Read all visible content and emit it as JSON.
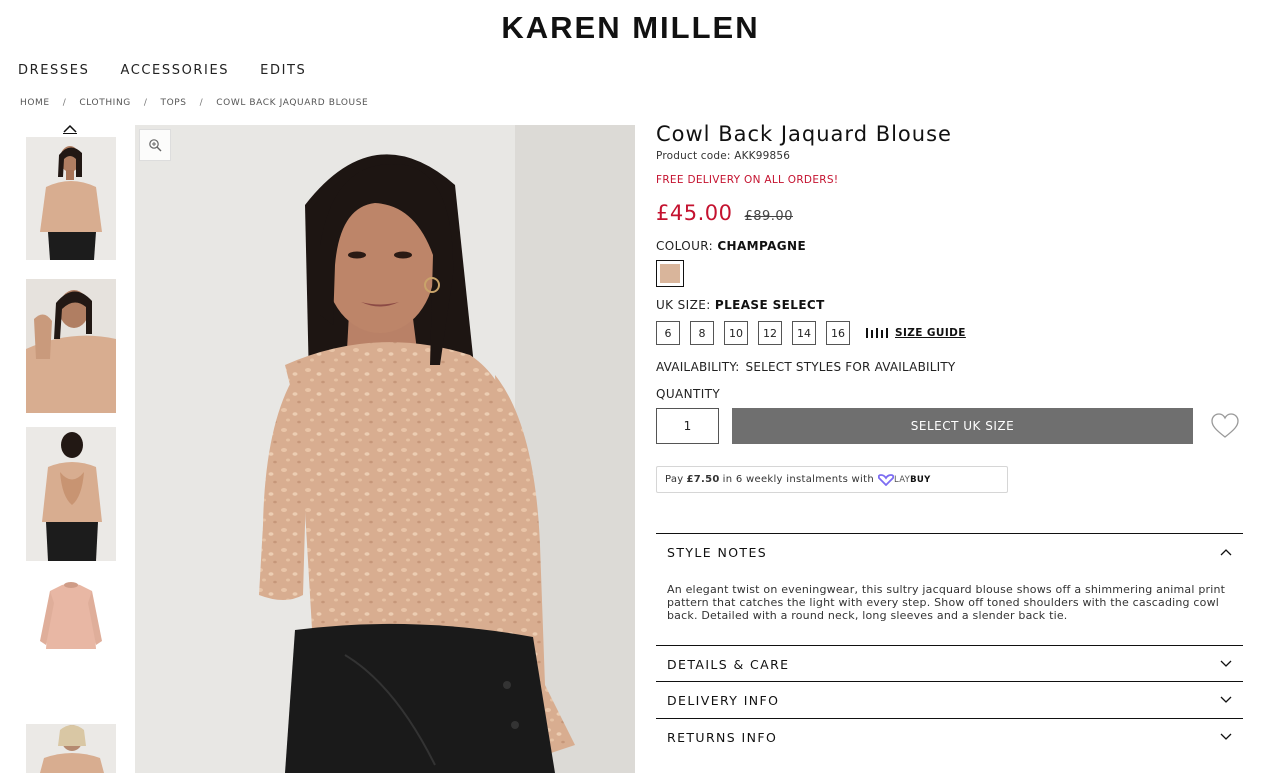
{
  "brand": "KAREN MILLEN",
  "nav": [
    "DRESSES",
    "ACCESSORIES",
    "EDITS"
  ],
  "breadcrumb": [
    "HOME",
    "CLOTHING",
    "TOPS",
    "COWL BACK JAQUARD BLOUSE"
  ],
  "product": {
    "title": "Cowl Back Jaquard Blouse",
    "code": "Product code: AKK99856",
    "promo": "FREE DELIVERY ON ALL ORDERS!",
    "price": "£45.00",
    "was_price": "£89.00",
    "colour_label": "COLOUR:",
    "colour_value": "CHAMPAGNE",
    "swatch_color": "#d9b59b",
    "size_label": "UK SIZE:",
    "size_value": "PLEASE SELECT",
    "sizes": [
      "6",
      "8",
      "10",
      "12",
      "14",
      "16"
    ],
    "size_guide": "SIZE GUIDE",
    "availability_label": "AVAILABILITY:",
    "availability_value": "SELECT STYLES FOR AVAILABILITY",
    "quantity_label": "QUANTITY",
    "quantity": "1",
    "cta": "SELECT UK SIZE"
  },
  "laybuy": {
    "pay": "Pay",
    "amount": "£7.50",
    "rest": "in 6 weekly instalments with",
    "logo_lay": "LAY",
    "logo_buy": "BUY"
  },
  "accordion": {
    "style_notes": {
      "title": "STYLE NOTES",
      "body": "An elegant twist on eveningwear, this sultry jacquard blouse shows off a shimmering animal print pattern that catches the light with every step. Show off toned shoulders with the cascading cowl back. Detailed with a round neck, long sleeves and a slender back tie."
    },
    "details": "DETAILS & CARE",
    "delivery": "DELIVERY INFO",
    "returns": "RETURNS INFO"
  },
  "colors": {
    "sale_red": "#c4122f",
    "cta_grey": "#6f6f6f",
    "blouse": "#d8ad90",
    "laybuy_purple": "#7c6cf2"
  }
}
